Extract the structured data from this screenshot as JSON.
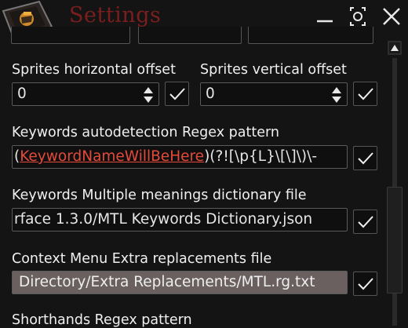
{
  "window": {
    "title": "Settings",
    "icons": {
      "app": "app-logo-icon",
      "minimize": "minimize-icon",
      "config": "gear-icon",
      "close": "close-icon"
    }
  },
  "accent": {
    "danger": "#e44a3a",
    "title": "#7a1e1e"
  },
  "offsets": {
    "horizontal_label": "Sprites horizontal offset",
    "horizontal_value": "0",
    "vertical_label": "Sprites vertical offset",
    "vertical_value": "0"
  },
  "regex": {
    "label": "Keywords autodetection Regex pattern",
    "value_prefix": "(",
    "value_link": "KeywordNameWillBeHere",
    "value_suffix": ")(?![\\p{L}\\[\\]\\)\\-"
  },
  "dictionary": {
    "label": "Keywords Multiple meanings dictionary file",
    "value": "rface 1.3.0/MTL Keywords Dictionary.json"
  },
  "context_menu": {
    "label": "Context Menu Extra replacements file",
    "value": "Directory/Extra Replacements/MTL.rg.txt"
  },
  "shorthands": {
    "label": "Shorthands Regex pattern"
  }
}
